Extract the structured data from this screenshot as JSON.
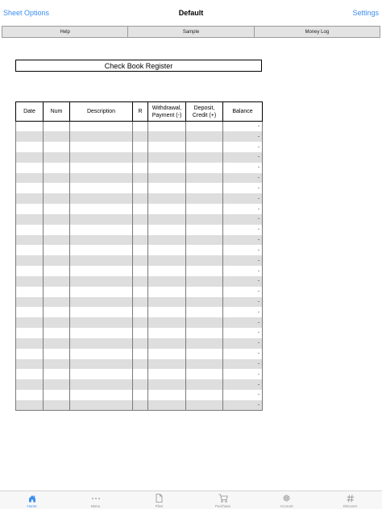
{
  "navbar": {
    "left_label": "Sheet Options",
    "title": "Default",
    "right_label": "Settings"
  },
  "tabs": [
    {
      "label": "Help"
    },
    {
      "label": "Sample"
    },
    {
      "label": "Money Log"
    }
  ],
  "register": {
    "title": "Check Book Register",
    "columns": [
      {
        "label": "Date"
      },
      {
        "label": "Num"
      },
      {
        "label": "Description"
      },
      {
        "label": "R"
      },
      {
        "label": "Withdrawal,\nPayment (-)"
      },
      {
        "label": "Deposit,\nCredit (+)"
      },
      {
        "label": "Balance"
      }
    ],
    "balance_placeholder": "-",
    "row_count": 28
  },
  "bottom_nav": [
    {
      "label": "Home",
      "icon": "home-icon",
      "active": true
    },
    {
      "label": "Menu",
      "icon": "more-icon",
      "active": false
    },
    {
      "label": "Files",
      "icon": "file-icon",
      "active": false
    },
    {
      "label": "Purchase",
      "icon": "cart-icon",
      "active": false
    },
    {
      "label": "Account",
      "icon": "gear-icon",
      "active": false
    },
    {
      "label": "Discover",
      "icon": "hash-icon",
      "active": false
    }
  ],
  "colors": {
    "accent": "#3b8ef0",
    "row_shade": "#dedede",
    "tab_background": "#e3e3e3"
  }
}
